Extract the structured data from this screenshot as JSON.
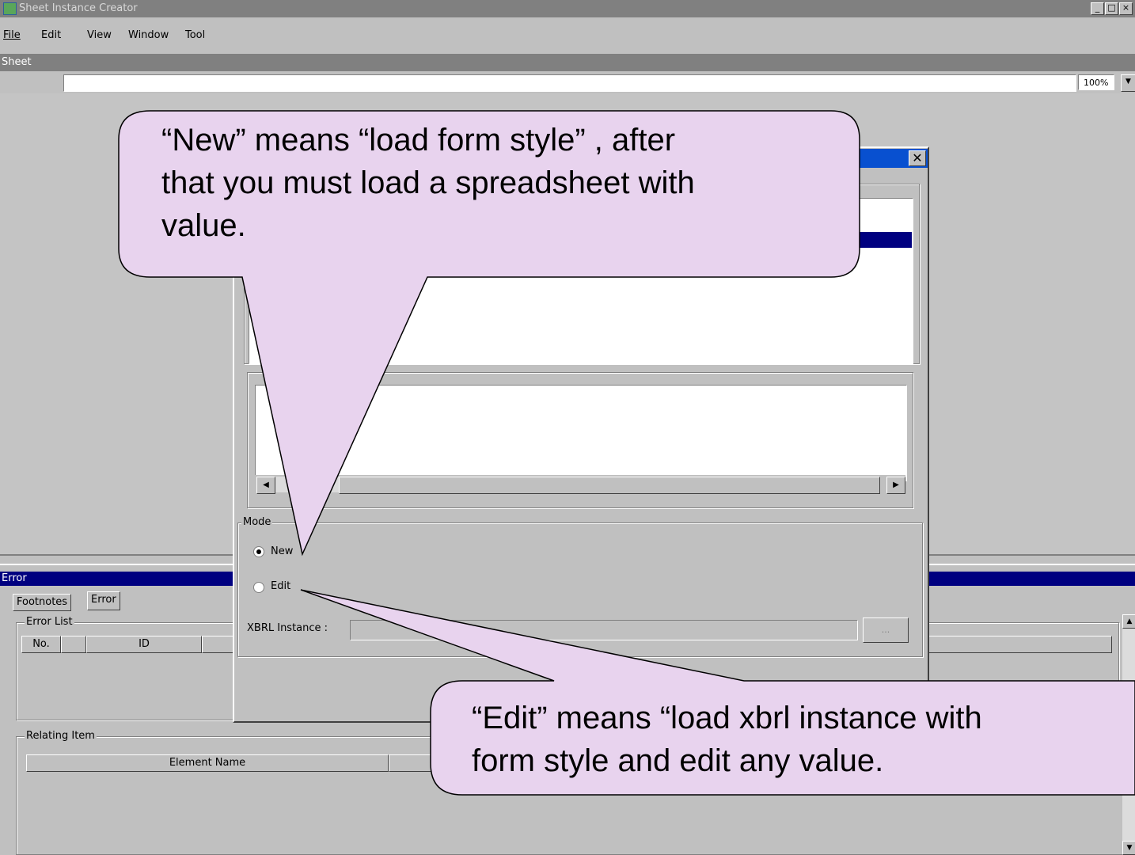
{
  "window": {
    "title": "Sheet Instance Creator",
    "min_glyph": "_",
    "max_glyph": "□"
  },
  "menu": [
    {
      "label": "File"
    },
    {
      "label": "Edit"
    },
    {
      "label": "View"
    },
    {
      "label": "Window"
    },
    {
      "label": "Tool"
    }
  ],
  "sheet_panel": {
    "caption": "Sheet",
    "formula_value": "",
    "zoom": "100%"
  },
  "error_panel": {
    "caption": "Error",
    "tabs": [
      "Footnotes",
      "Error"
    ],
    "active_tab": "Error",
    "error_list": {
      "legend": "Error List",
      "columns": [
        "No.",
        "",
        "ID",
        ""
      ]
    },
    "relating_item": {
      "legend": "Relating Item",
      "columns": [
        "Element Name",
        ""
      ]
    }
  },
  "dialog": {
    "title": "",
    "close_glyph": "✕",
    "list_frame_legend": "",
    "detail_frame_legend": "",
    "mode": {
      "legend": "Mode",
      "options": [
        {
          "label": "New",
          "selected": true
        },
        {
          "label": "Edit",
          "selected": false
        }
      ],
      "xbrl_label": "XBRL Instance :",
      "xbrl_value": "",
      "browse_label": "..."
    }
  },
  "callouts": {
    "new_line1": "“New” means “load form style” , after",
    "new_line2": "that you must load a spreadsheet with",
    "new_line3": "value.",
    "edit_line1": "“Edit” means “load xbrl instance with",
    "edit_line2": "form style and edit any value."
  },
  "colors": {
    "callout_fill": "#e8d3ee",
    "active_caption": "#000080",
    "dialog_caption": "#0850d0",
    "face": "#c0c0c0"
  }
}
